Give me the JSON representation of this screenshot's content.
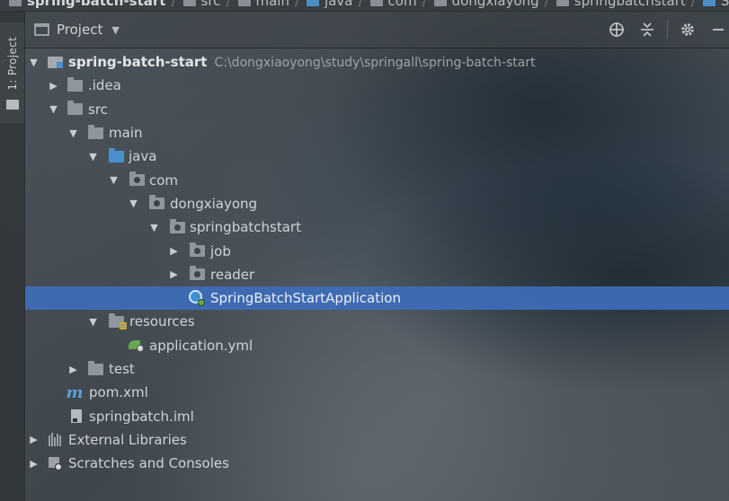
{
  "breadcrumb": {
    "items": [
      {
        "label": "spring-batch-start",
        "icon": "project-folder-icon",
        "bold": true
      },
      {
        "label": "src",
        "icon": "folder-icon"
      },
      {
        "label": "main",
        "icon": "folder-icon"
      },
      {
        "label": "java",
        "icon": "source-folder-icon"
      },
      {
        "label": "com",
        "icon": "package-icon"
      },
      {
        "label": "dongxiayong",
        "icon": "package-icon"
      },
      {
        "label": "springbatchstart",
        "icon": "package-icon"
      },
      {
        "label": "Spri",
        "icon": "spring-class-icon"
      }
    ]
  },
  "toolstrip": {
    "project_tab_label": "1: Project"
  },
  "panel": {
    "title": "Project",
    "tools": [
      "locate-icon",
      "collapse-all-icon",
      "settings-gear-icon",
      "hide-minus-icon"
    ]
  },
  "tree": {
    "rows": [
      {
        "name": "spring-batch-start",
        "path": "C:\\dongxiaoyong\\study\\springall\\spring-batch-start",
        "bold": true
      },
      {
        "name": ".idea"
      },
      {
        "name": "src"
      },
      {
        "name": "main"
      },
      {
        "name": "java"
      },
      {
        "name": "com"
      },
      {
        "name": "dongxiayong"
      },
      {
        "name": "springbatchstart"
      },
      {
        "name": "job"
      },
      {
        "name": "reader"
      },
      {
        "name": "SpringBatchStartApplication",
        "selected": true
      },
      {
        "name": "resources"
      },
      {
        "name": "application.yml"
      },
      {
        "name": "test"
      },
      {
        "name": "pom.xml"
      },
      {
        "name": "springbatch.iml"
      },
      {
        "name": "External Libraries"
      },
      {
        "name": "Scratches and Consoles"
      }
    ]
  },
  "colors": {
    "selection": "#3e6cb8",
    "source_folder": "#4b8fcc",
    "spring_green": "#6aa84f"
  }
}
